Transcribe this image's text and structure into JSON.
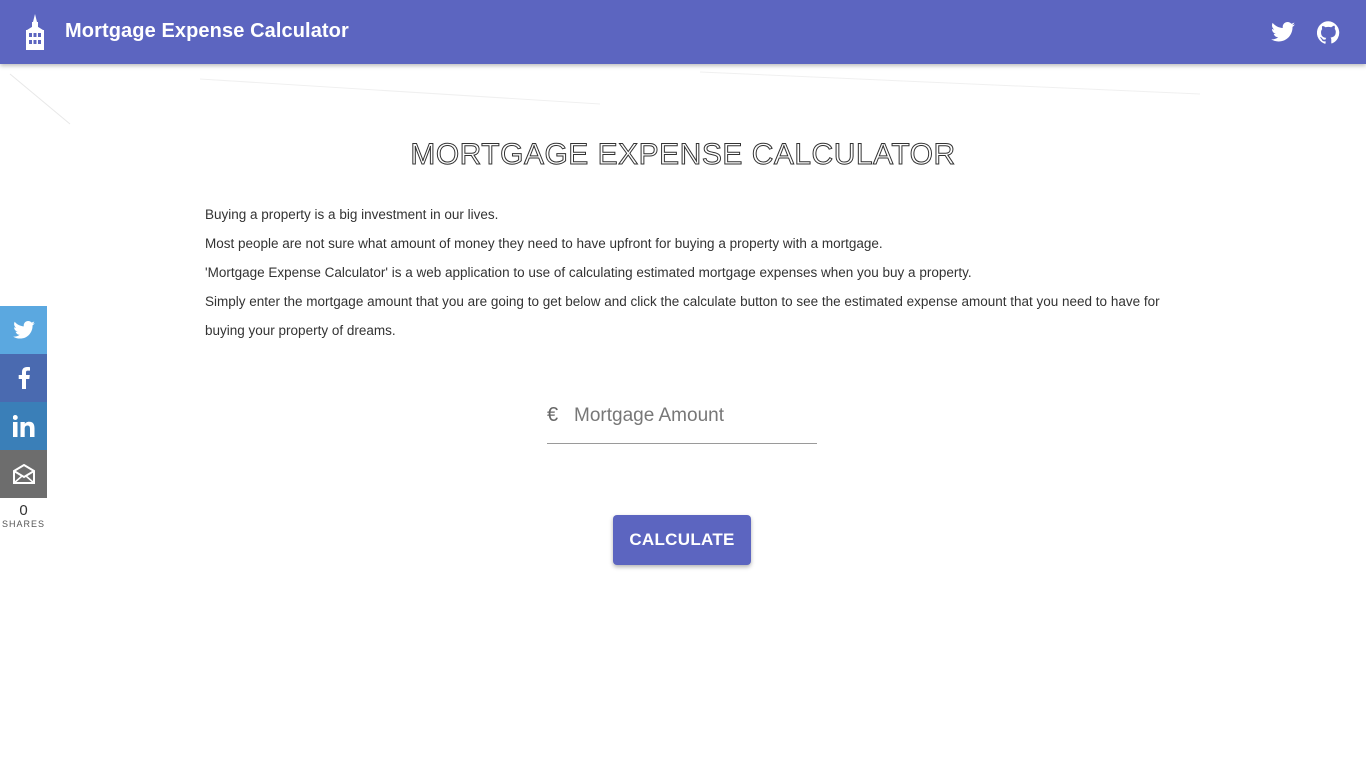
{
  "appbar": {
    "title": "Mortgage Expense Calculator",
    "color": "#5c65c0",
    "icons": [
      "building-logo-icon",
      "twitter-icon",
      "github-icon"
    ]
  },
  "main": {
    "heading": "MORTGAGE EXPENSE CALCULATOR",
    "paragraphs": [
      "Buying a property is a big investment in our lives.",
      "Most people are not sure what amount of money they need to have upfront for buying a property with a mortgage.",
      "'Mortgage Expense Calculator' is a web application to use of calculating estimated mortgage expenses when you buy a property.",
      "Simply enter the mortgage amount that you are going to get below and click the calculate button to see the estimated expense amount that you need to have for buying your property of dreams."
    ],
    "amount_field": {
      "prefix": "€",
      "placeholder": "Mortgage Amount",
      "value": ""
    },
    "calculate_label": "CALCULATE"
  },
  "share": {
    "buttons": [
      "twitter",
      "facebook",
      "linkedin",
      "email"
    ],
    "count": "0",
    "label": "SHARES",
    "colors": {
      "twitter": "#5ba8e0",
      "facebook": "#4a6ab0",
      "linkedin": "#3a7fb8",
      "email": "#6d6d6d"
    }
  }
}
